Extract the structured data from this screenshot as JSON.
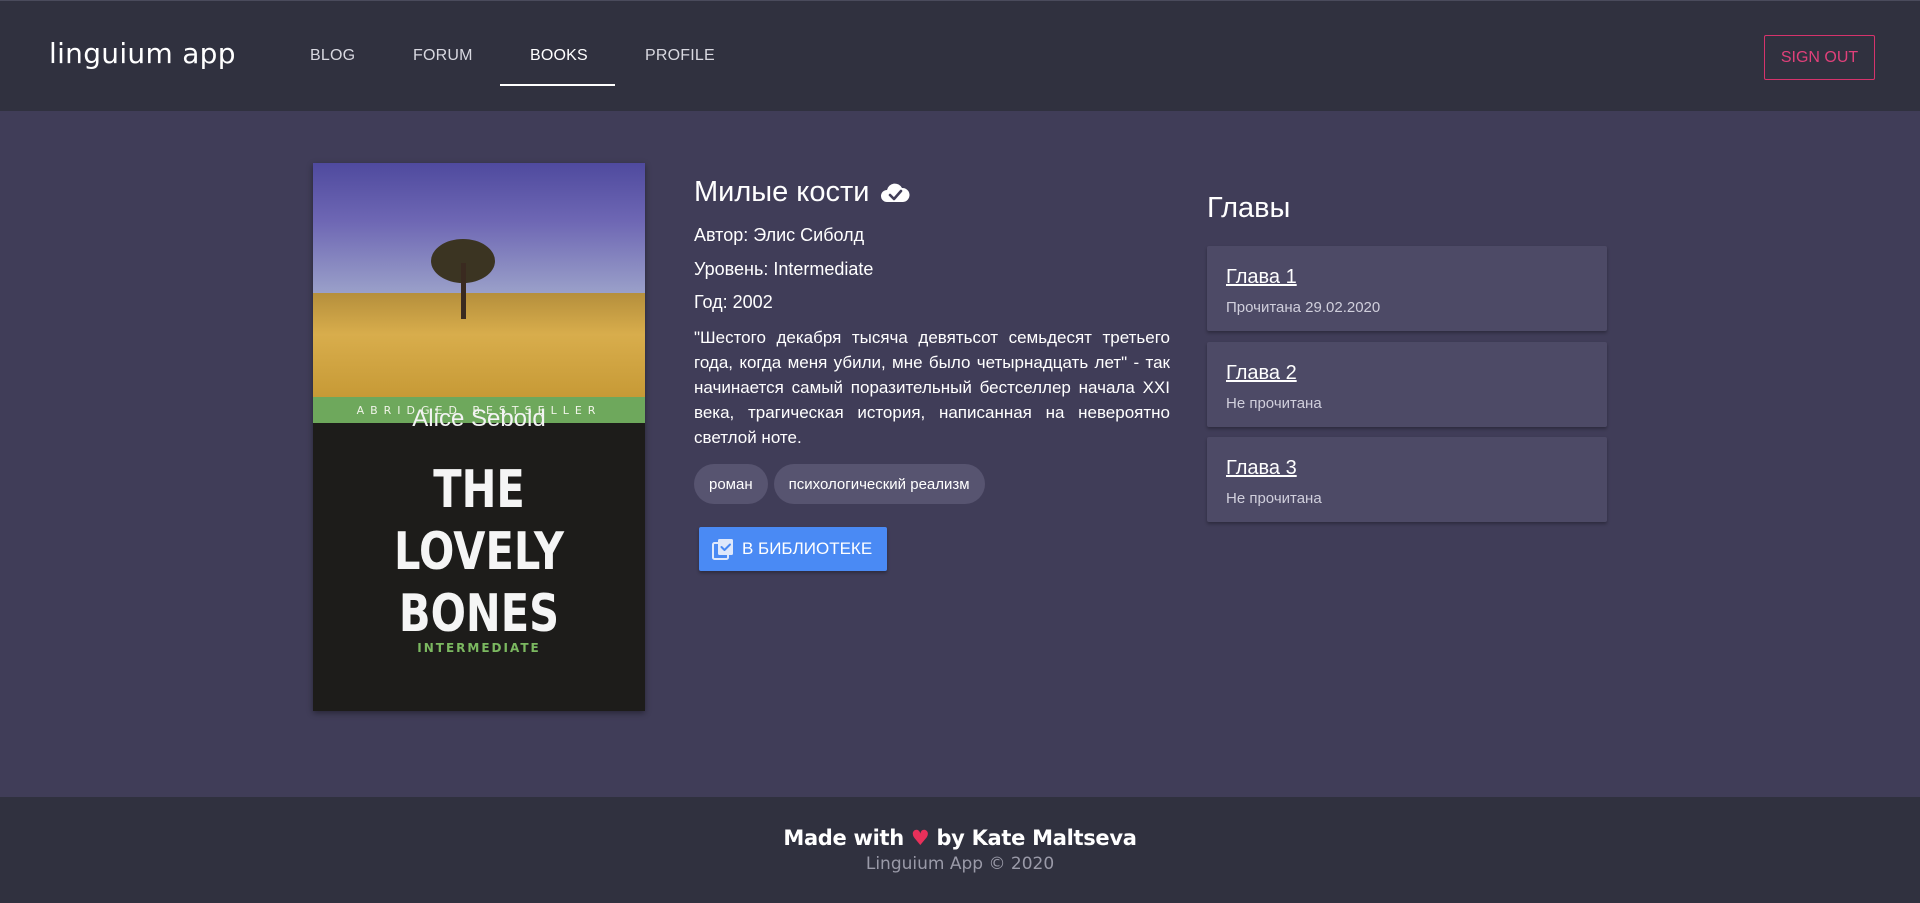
{
  "header": {
    "brand": "linguium app",
    "nav": [
      {
        "label": "BLOG"
      },
      {
        "label": "FORUM"
      },
      {
        "label": "BOOKS"
      },
      {
        "label": "PROFILE"
      }
    ],
    "active_nav": "BOOKS",
    "signout_label": "SIGN OUT"
  },
  "cover": {
    "band_text": "ABRIDGED BESTSELLER",
    "author": "Alice Sebold",
    "title_line1": "THE LOVELY",
    "title_line2": "BONES",
    "level": "INTERMEDIATE"
  },
  "book": {
    "title": "Милые кости",
    "status_icon": "cloud-check-icon",
    "author": "Автор: Элис Сиболд",
    "level": "Уровень: Intermediate",
    "year": "Год: 2002",
    "description": "\"Шестого декабря тысяча девятьсот семьдесят третьего года, когда меня убили, мне было четырнадцать лет\" - так начинается самый поразительный бестселлер начала XXI века, трагическая история, написанная на невероятно светлой ноте.",
    "tags": [
      "роман",
      "психологический реализм"
    ],
    "library_button": "В БИБЛИОТЕКЕ",
    "library_icon": "library-check-icon"
  },
  "chapters": {
    "title": "Главы",
    "items": [
      {
        "name": "Глава 1",
        "status": "Прочитана 29.02.2020"
      },
      {
        "name": "Глава 2",
        "status": "Не прочитана"
      },
      {
        "name": "Глава 3",
        "status": "Не прочитана"
      }
    ]
  },
  "footer": {
    "made_prefix": "Made with",
    "heart": "♥",
    "made_suffix": "by Kate Maltseva",
    "copyright": "Linguium App © 2020"
  },
  "colors": {
    "background": "#403d58",
    "header": "#30313f",
    "accent_pink": "#e0407a",
    "button_blue": "#4a8af4",
    "card": "#4d4a66"
  }
}
